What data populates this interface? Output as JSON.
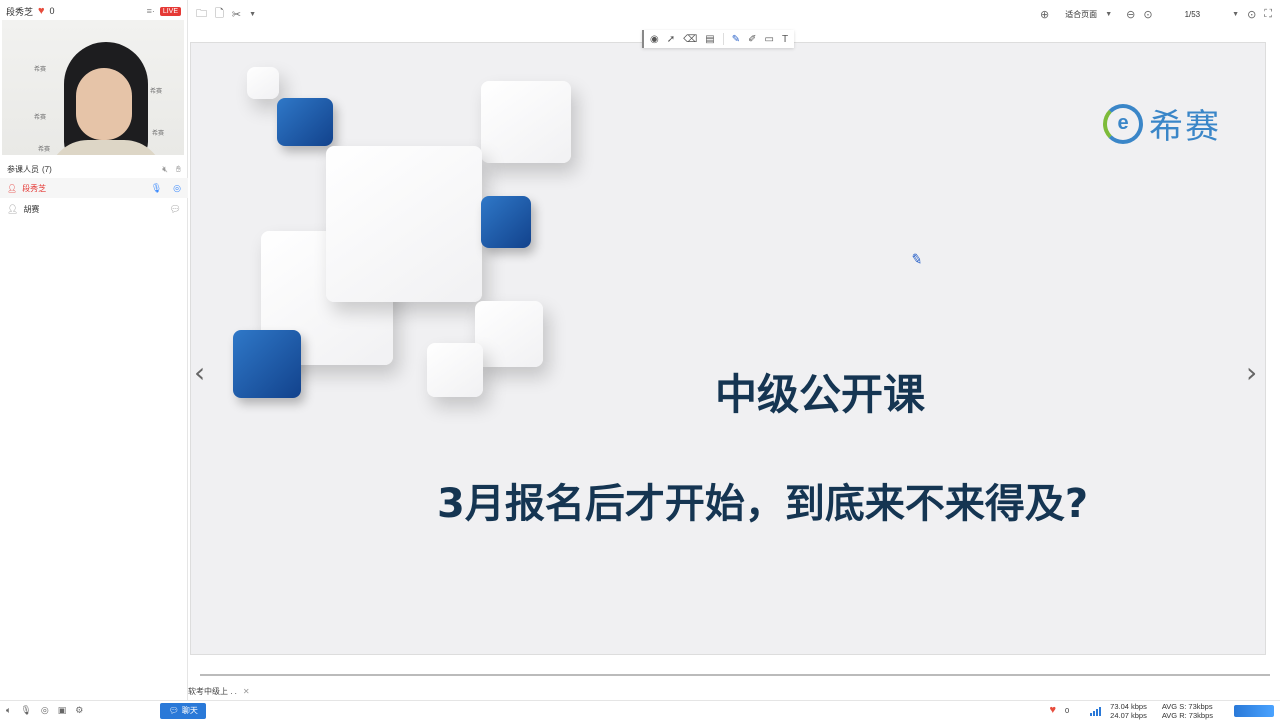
{
  "left_panel": {
    "presenter_name": "段秀芝",
    "like_count": "0",
    "live_badge": "LIVE",
    "video_posters": [
      "希赛",
      "希赛",
      "希赛",
      "希赛",
      "希赛"
    ],
    "participants_label": "参课人员",
    "participants_count": "(7)",
    "participants": [
      {
        "name": "段秀芝",
        "role": "presenter"
      },
      {
        "name": "胡赛",
        "role": "attendee"
      }
    ]
  },
  "toolbar": {
    "zoom_label": "适合页面",
    "page_indicator": "1/53"
  },
  "slide": {
    "logo_text": "希赛",
    "title": "中级公开课",
    "subtitle": "3月报名后才开始，到底来不来得及?",
    "colors": {
      "accent_blue": "#1f5aa6",
      "title_text": "#153552",
      "logo_blue": "#3a86c8",
      "logo_green": "#7dbb3a"
    }
  },
  "bottom": {
    "doc_tab_label": "软考中级上 . .",
    "chat_button": "聊天",
    "heart_count": "0",
    "upload_rate": "73.04 kbps",
    "download_rate": "24.07 kbps",
    "avg_send": "AVG S: 73kbps",
    "avg_recv": "AVG R: 73kbps"
  }
}
